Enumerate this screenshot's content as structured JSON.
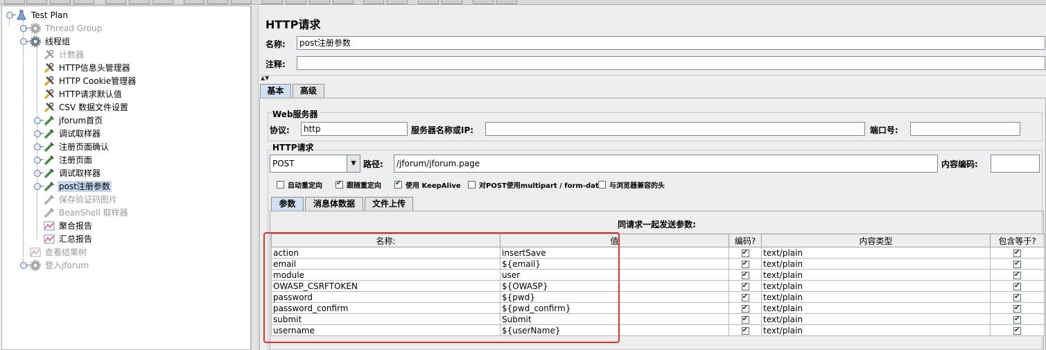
{
  "tree": [
    {
      "label": "Test Plan",
      "icon": "flask-icon",
      "indent": 0,
      "disabled": false,
      "selected": false,
      "toggle": true
    },
    {
      "label": "Thread Group",
      "icon": "gear-icon",
      "indent": 1,
      "disabled": true,
      "selected": false,
      "toggle": true
    },
    {
      "label": "线程组",
      "icon": "gear-icon",
      "indent": 1,
      "disabled": false,
      "selected": false,
      "toggle": true
    },
    {
      "label": "计数器",
      "icon": "wrench-icon",
      "indent": 2,
      "disabled": true,
      "selected": false,
      "toggle": false
    },
    {
      "label": "HTTP信息头管理器",
      "icon": "wrench-icon",
      "indent": 2,
      "disabled": false,
      "selected": false,
      "toggle": false
    },
    {
      "label": "HTTP Cookie管理器",
      "icon": "wrench-icon",
      "indent": 2,
      "disabled": false,
      "selected": false,
      "toggle": false
    },
    {
      "label": "HTTP请求默认值",
      "icon": "wrench-icon",
      "indent": 2,
      "disabled": false,
      "selected": false,
      "toggle": false
    },
    {
      "label": "CSV 数据文件设置",
      "icon": "wrench-icon",
      "indent": 2,
      "disabled": false,
      "selected": false,
      "toggle": false
    },
    {
      "label": "jforum首页",
      "icon": "pipette-icon",
      "indent": 2,
      "disabled": false,
      "selected": false,
      "toggle": true
    },
    {
      "label": "调试取样器",
      "icon": "pipette-icon",
      "indent": 2,
      "disabled": false,
      "selected": false,
      "toggle": true
    },
    {
      "label": "注册页面确认",
      "icon": "pipette-icon",
      "indent": 2,
      "disabled": false,
      "selected": false,
      "toggle": true
    },
    {
      "label": "注册页面",
      "icon": "pipette-icon",
      "indent": 2,
      "disabled": false,
      "selected": false,
      "toggle": true
    },
    {
      "label": "调试取样器",
      "icon": "pipette-icon",
      "indent": 2,
      "disabled": false,
      "selected": false,
      "toggle": true
    },
    {
      "label": "post注册参数",
      "icon": "pipette-icon",
      "indent": 2,
      "disabled": false,
      "selected": true,
      "toggle": true
    },
    {
      "label": "保存验证码图片",
      "icon": "pipette-icon",
      "indent": 2,
      "disabled": true,
      "selected": false,
      "toggle": false
    },
    {
      "label": "BeanShell 取样器",
      "icon": "pipette-icon",
      "indent": 2,
      "disabled": true,
      "selected": false,
      "toggle": false
    },
    {
      "label": "聚合报告",
      "icon": "chart-icon",
      "indent": 2,
      "disabled": false,
      "selected": false,
      "toggle": false
    },
    {
      "label": "汇总报告",
      "icon": "chart-icon",
      "indent": 2,
      "disabled": false,
      "selected": false,
      "toggle": false
    },
    {
      "label": "查看结果树",
      "icon": "chart-icon",
      "indent": 1,
      "disabled": true,
      "selected": false,
      "toggle": false
    },
    {
      "label": "登入jforum",
      "icon": "gear-icon",
      "indent": 1,
      "disabled": true,
      "selected": false,
      "toggle": true
    }
  ],
  "panel": {
    "title": "HTTP请求",
    "name_label": "名称:",
    "name_value": "post注册参数",
    "comment_label": "注释:",
    "comment_value": ""
  },
  "main_tabs": [
    "基本",
    "高级"
  ],
  "web_server": {
    "group_label": "Web服务器",
    "protocol_label": "协议:",
    "protocol_value": "http",
    "server_label": "服务器名称或IP:",
    "server_value": "",
    "port_label": "端口号:",
    "port_value": ""
  },
  "http_request": {
    "group_label": "HTTP请求",
    "method": "POST",
    "path_label": "路径:",
    "path_value": "/jforum/jforum.page",
    "encoding_label": "内容编码:",
    "encoding_value": ""
  },
  "options": [
    {
      "label": "自动重定向",
      "checked": false
    },
    {
      "label": "跟随重定向",
      "checked": true
    },
    {
      "label": "使用 KeepAlive",
      "checked": true
    },
    {
      "label": "对POST使用multipart / form-data",
      "checked": false
    },
    {
      "label": "与浏览器兼容的头",
      "checked": false
    }
  ],
  "sub_tabs": [
    "参数",
    "消息体数据",
    "文件上传"
  ],
  "params": {
    "caption": "同请求一起发送参数:",
    "headers": [
      "名称:",
      "值",
      "编码?",
      "内容类型",
      "包含等于?"
    ],
    "rows": [
      {
        "name": "action",
        "value": "insertSave",
        "encode": true,
        "content_type": "text/plain",
        "include_equals": true
      },
      {
        "name": "email",
        "value": "${email}",
        "encode": true,
        "content_type": "text/plain",
        "include_equals": true
      },
      {
        "name": "module",
        "value": "user",
        "encode": true,
        "content_type": "text/plain",
        "include_equals": true
      },
      {
        "name": "OWASP_CSRFTOKEN",
        "value": "${OWASP}",
        "encode": true,
        "content_type": "text/plain",
        "include_equals": true
      },
      {
        "name": "password",
        "value": "${pwd}",
        "encode": true,
        "content_type": "text/plain",
        "include_equals": true
      },
      {
        "name": "password_confirm",
        "value": "${pwd_confirm}",
        "encode": true,
        "content_type": "text/plain",
        "include_equals": true
      },
      {
        "name": "submit",
        "value": "Submit",
        "encode": true,
        "content_type": "text/plain",
        "include_equals": true
      },
      {
        "name": "username",
        "value": "${userName}",
        "encode": true,
        "content_type": "text/plain",
        "include_equals": true
      }
    ]
  },
  "colors": {
    "highlight_box": "#e4312b",
    "selected_row": "#c5d7ee",
    "active_tab": "#cfe0f2"
  }
}
